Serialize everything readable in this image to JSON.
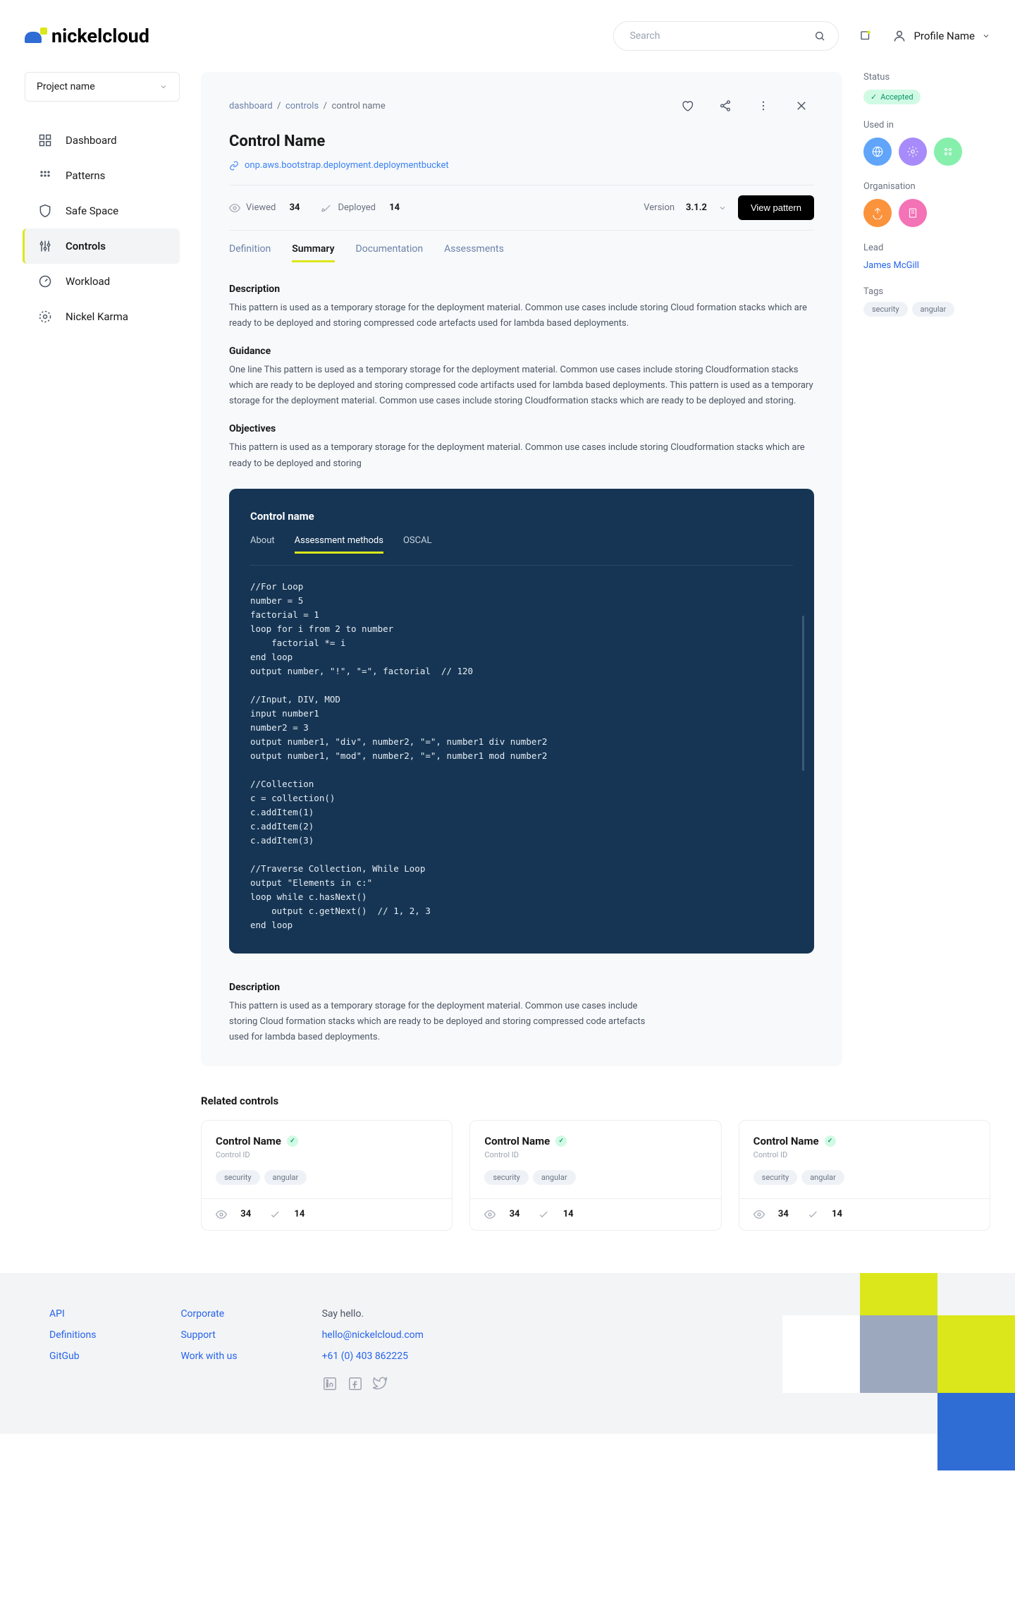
{
  "brand": "nickelcloud",
  "search": {
    "placeholder": "Search"
  },
  "profile": {
    "label": "Profile Name"
  },
  "projectSelector": "Project name",
  "nav": [
    {
      "label": "Dashboard",
      "icon": "grid"
    },
    {
      "label": "Patterns",
      "icon": "dots"
    },
    {
      "label": "Safe Space",
      "icon": "shield"
    },
    {
      "label": "Controls",
      "icon": "sliders",
      "active": true
    },
    {
      "label": "Workload",
      "icon": "gauge"
    },
    {
      "label": "Nickel Karma",
      "icon": "sparkle"
    }
  ],
  "breadcrumb": {
    "dashboard": "dashboard",
    "controls": "controls",
    "current": "control name"
  },
  "control": {
    "title": "Control Name",
    "link": "onp.aws.bootstrap.deployment.deploymentbucket",
    "viewedLabel": "Viewed",
    "viewedCount": "34",
    "deployedLabel": "Deployed",
    "deployedCount": "14",
    "versionLabel": "Version",
    "version": "3.1.2",
    "viewPatternBtn": "View pattern"
  },
  "tabs": [
    "Definition",
    "Summary",
    "Documentation",
    "Assessments"
  ],
  "activeTab": "Summary",
  "sections": {
    "descriptionH": "Description",
    "descriptionP": "This pattern is used as a temporary storage for the deployment material. Common use cases include storing Cloud formation stacks which are ready to be deployed and storing compressed code artefacts used for lambda based deployments.",
    "guidanceH": "Guidance",
    "guidanceP": "One line This pattern is used as a temporary storage for the deployment material. Common use cases include storing Cloudformation stacks which are ready to be deployed and storing compressed code artifacts used for lambda based deployments. This pattern is used as a temporary storage for the deployment material. Common use cases include storing Cloudformation stacks which are ready to be deployed and storing.",
    "objectivesH": "Objectives",
    "objectivesP": "This pattern is used as a temporary storage for the deployment material. Common use cases include storing Cloudformation stacks which are ready to be deployed and storing",
    "desc2H": "Description",
    "desc2P": "This pattern is used as a temporary storage for the deployment material. Common use cases include storing Cloud formation stacks which are ready to be deployed and storing compressed code artefacts used for lambda based deployments."
  },
  "codePanel": {
    "title": "Control name",
    "tabs": [
      "About",
      "Assessment methods",
      "OSCAL"
    ],
    "activeTab": "Assessment methods",
    "code": "//For Loop\nnumber = 5\nfactorial = 1\nloop for i from 2 to number\n    factorial *= i\nend loop\noutput number, \"!\", \"=\", factorial  // 120\n\n//Input, DIV, MOD\ninput number1\nnumber2 = 3\noutput number1, \"div\", number2, \"=\", number1 div number2\noutput number1, \"mod\", number2, \"=\", number1 mod number2\n\n//Collection\nc = collection()\nc.addItem(1)\nc.addItem(2)\nc.addItem(3)\n\n//Traverse Collection, While Loop\noutput \"Elements in c:\"\nloop while c.hasNext()\n    output c.getNext()  // 1, 2, 3\nend loop"
  },
  "aside": {
    "statusLabel": "Status",
    "statusValue": "Accepted",
    "usedInLabel": "Used in",
    "orgLabel": "Organisation",
    "leadLabel": "Lead",
    "leadValue": "James McGill",
    "tagsLabel": "Tags",
    "tags": [
      "security",
      "angular"
    ]
  },
  "related": {
    "title": "Related controls",
    "cards": [
      {
        "name": "Control Name",
        "id": "Control ID",
        "tags": [
          "security",
          "angular"
        ],
        "views": "34",
        "deploys": "14"
      },
      {
        "name": "Control Name",
        "id": "Control ID",
        "tags": [
          "security",
          "angular"
        ],
        "views": "34",
        "deploys": "14"
      },
      {
        "name": "Control Name",
        "id": "Control ID",
        "tags": [
          "security",
          "angular"
        ],
        "views": "34",
        "deploys": "14"
      }
    ]
  },
  "footer": {
    "col1": [
      "API",
      "Definitions",
      "GitGub"
    ],
    "col2": [
      "Corporate",
      "Support",
      "Work with us"
    ],
    "sayHello": "Say hello.",
    "email": "hello@nickelcloud.com",
    "phone": "+61 (0) 403 862225"
  }
}
